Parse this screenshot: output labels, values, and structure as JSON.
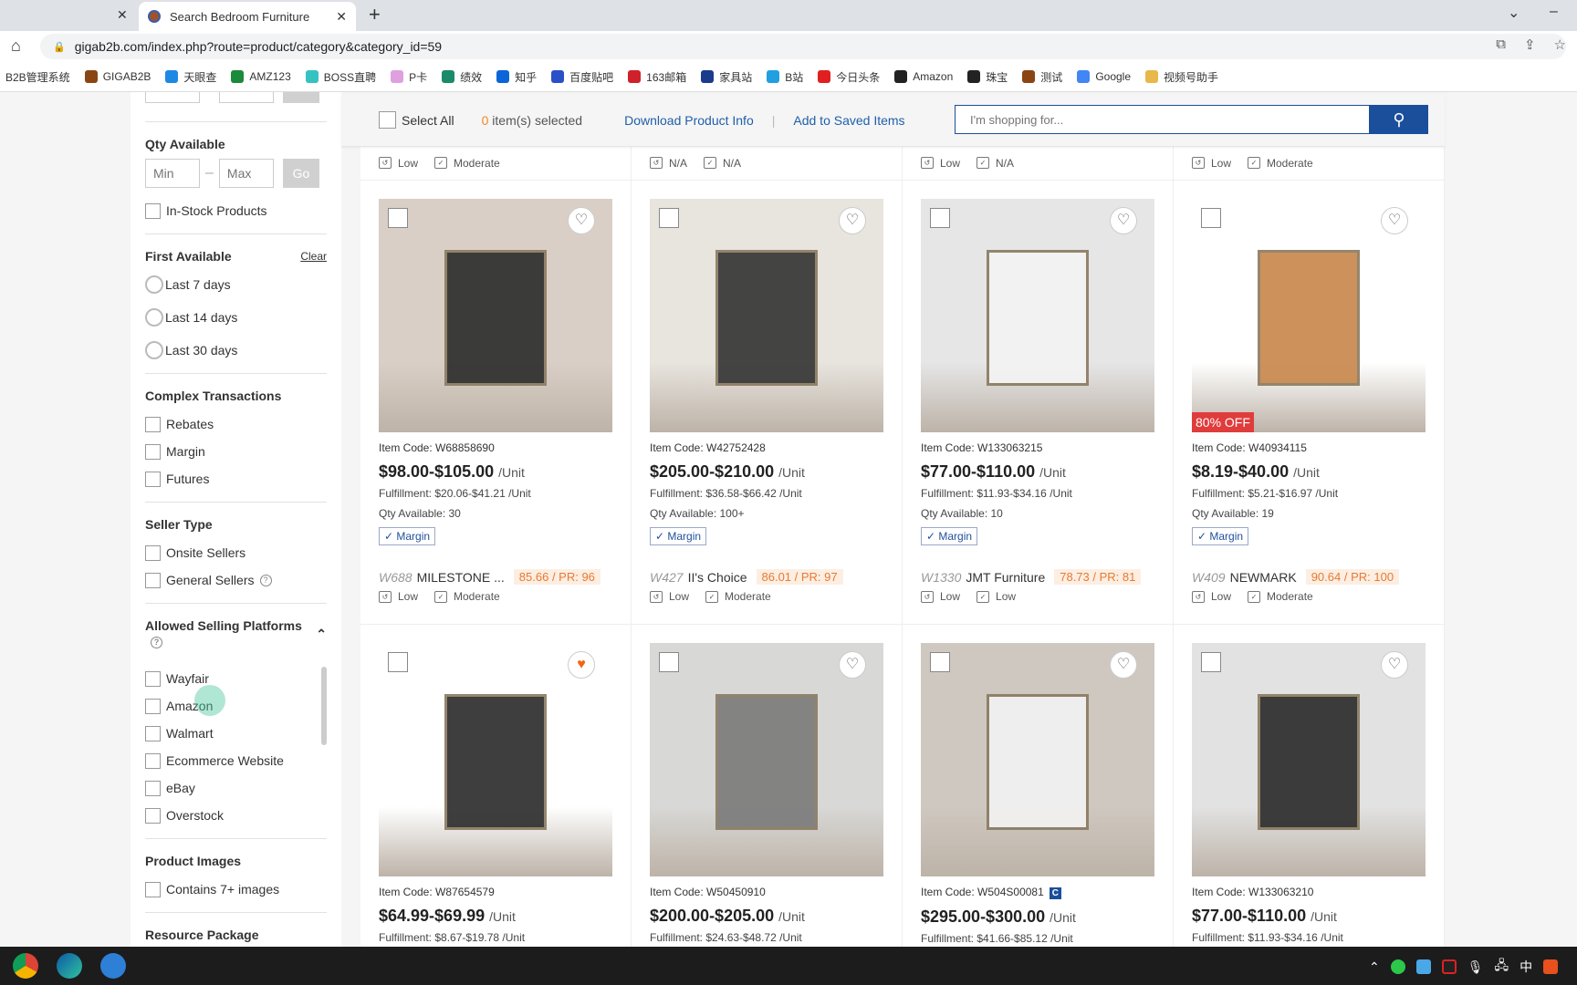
{
  "browser": {
    "tab_title": "Search Bedroom Furniture",
    "url": "gigab2b.com/index.php?route=product/category&category_id=59",
    "bookmarks": [
      {
        "label": "B2B管理系统",
        "color": ""
      },
      {
        "label": "GIGAB2B",
        "color": "#8b4513"
      },
      {
        "label": "天眼查",
        "color": "#1e88e5"
      },
      {
        "label": "AMZ123",
        "color": "#1b8a3a"
      },
      {
        "label": "BOSS直聘",
        "color": "#37c2c2"
      },
      {
        "label": "P卡",
        "color": "#e0a0e0"
      },
      {
        "label": "绩效",
        "color": "#1a8a6a"
      },
      {
        "label": "知乎",
        "color": "#0a66d8"
      },
      {
        "label": "百度贴吧",
        "color": "#2a50c8"
      },
      {
        "label": "163邮箱",
        "color": "#d0202a"
      },
      {
        "label": "家具站",
        "color": "#1b3c8c"
      },
      {
        "label": "B站",
        "color": "#20a0e0"
      },
      {
        "label": "今日头条",
        "color": "#e02020"
      },
      {
        "label": "Amazon",
        "color": "#222"
      },
      {
        "label": "珠宝",
        "color": "#222"
      },
      {
        "label": "测试",
        "color": "#8b4513"
      },
      {
        "label": "Google",
        "color": "#4285f4"
      },
      {
        "label": "视频号助手",
        "color": "#e8b84a"
      }
    ]
  },
  "sidebar": {
    "qty": {
      "title": "Qty Available",
      "min_placeholder": "Min",
      "max_placeholder": "Max",
      "go": "Go",
      "instock": "In-Stock Products"
    },
    "first_available": {
      "title": "First Available",
      "clear": "Clear",
      "options": [
        "Last 7 days",
        "Last 14 days",
        "Last 30 days"
      ]
    },
    "complex": {
      "title": "Complex Transactions",
      "options": [
        "Rebates",
        "Margin",
        "Futures"
      ]
    },
    "seller_type": {
      "title": "Seller Type",
      "options": [
        "Onsite Sellers",
        "General Sellers"
      ]
    },
    "platforms": {
      "title": "Allowed Selling Platforms",
      "options": [
        "Wayfair",
        "Amazon",
        "Walmart",
        "Ecommerce Website",
        "eBay",
        "Overstock"
      ]
    },
    "images": {
      "title": "Product Images",
      "options": [
        "Contains 7+ images"
      ]
    },
    "resource": {
      "title": "Resource Package"
    }
  },
  "toolbar": {
    "select_all": "Select All",
    "selected_count": "0",
    "selected_label": " item(s) selected",
    "download": "Download Product Info",
    "save": "Add to Saved Items",
    "search_placeholder": "I'm shopping for..."
  },
  "partial_row": [
    [
      "Low",
      "Moderate"
    ],
    [
      "N/A",
      "N/A"
    ],
    [
      "Low",
      "N/A"
    ],
    [
      "Low",
      "Moderate"
    ]
  ],
  "products": [
    {
      "code": "W68858690",
      "price": "$98.00-$105.00",
      "unit": "/Unit",
      "fulfillment": "Fulfillment: $20.06-$41.21 /Unit",
      "qty": "Qty Available: 30",
      "tag": "Margin",
      "seller_id": "W688",
      "seller": "MILESTONE ...",
      "score": "85.66 / PR: 96",
      "risk": [
        "Low",
        "Moderate"
      ],
      "fav": false,
      "bg": "#d9cfc6",
      "prod": "#2b2b2b"
    },
    {
      "code": "W42752428",
      "price": "$205.00-$210.00",
      "unit": "/Unit",
      "fulfillment": "Fulfillment: $36.58-$66.42 /Unit",
      "qty": "Qty Available: 100+",
      "tag": "Margin",
      "seller_id": "W427",
      "seller": "II's Choice",
      "score": "86.01 / PR: 97",
      "risk": [
        "Low",
        "Moderate"
      ],
      "fav": false,
      "bg": "#e8e4de",
      "prod": "#333"
    },
    {
      "code": "W133063215",
      "price": "$77.00-$110.00",
      "unit": "/Unit",
      "fulfillment": "Fulfillment: $11.93-$34.16 /Unit",
      "qty": "Qty Available: 10",
      "tag": "Margin",
      "seller_id": "W1330",
      "seller": "JMT Furniture",
      "score": "78.73 / PR: 81",
      "risk": [
        "Low",
        "Low"
      ],
      "fav": false,
      "bg": "#e6e6e6",
      "prod": "#f4f4f4"
    },
    {
      "code": "W40934115",
      "price": "$8.19-$40.00",
      "unit": "/Unit",
      "fulfillment": "Fulfillment: $5.21-$16.97 /Unit",
      "qty": "Qty Available: 19",
      "tag": "Margin",
      "seller_id": "W409",
      "seller": "NEWMARK",
      "score": "90.64 / PR: 100",
      "risk": [
        "Low",
        "Moderate"
      ],
      "fav": false,
      "discount": "80% OFF",
      "bg": "#ffffff",
      "prod": "#c8864a"
    },
    {
      "code": "W87654579",
      "price": "$64.99-$69.99",
      "unit": "/Unit",
      "fulfillment": "Fulfillment: $8.67-$19.78 /Unit",
      "fav": true,
      "bg": "#ffffff",
      "prod": "#2a2a2a"
    },
    {
      "code": "W50450910",
      "price": "$200.00-$205.00",
      "unit": "/Unit",
      "fulfillment": "Fulfillment: $24.63-$48.72 /Unit",
      "fav": false,
      "bg": "#d8d8d6",
      "prod": "#7a7a7a"
    },
    {
      "code": "W504S00081",
      "badge": "C",
      "price": "$295.00-$300.00",
      "unit": "/Unit",
      "fulfillment": "Fulfillment: $41.66-$85.12 /Unit",
      "fav": false,
      "bg": "#cfc8c0",
      "prod": "#f3f3f3"
    },
    {
      "code": "W133063210",
      "price": "$77.00-$110.00",
      "unit": "/Unit",
      "fulfillment": "Fulfillment: $11.93-$34.16 /Unit",
      "fav": false,
      "bg": "#e2e2e2",
      "prod": "#2a2a2a"
    }
  ],
  "item_code_label": "Item Code:",
  "colors": {
    "accent": "#1b4f9c",
    "link": "#1f5fa8",
    "count": "#f08a24",
    "score_text": "#e77a33",
    "discount": "#e03c3c",
    "favorite": "#f06414"
  }
}
